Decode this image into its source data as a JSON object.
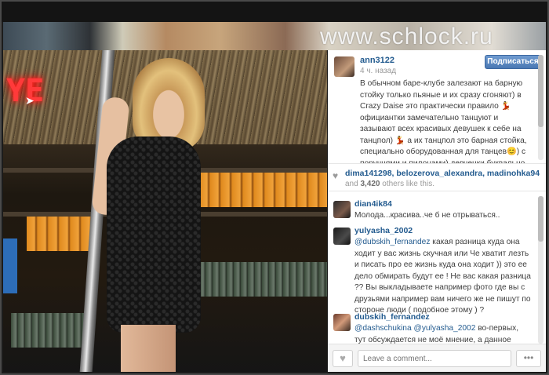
{
  "watermark": "www.schlock.ru",
  "photo": {
    "neon_text": "YE"
  },
  "post": {
    "username": "ann3122",
    "time": "4 ч. назад",
    "follow_label": "Подписаться",
    "caption": "В обычном баре-клубе залезают на барную стойку только пьяные и их сразу сгоняют) в Crazy Daise это практически правило 💃 официантки замечательно танцуют и зазывают всех красивых девушек к себе на танцпол) 💃 а их танцпол это барная стойка, специально оборудованная для танцев😊) с поручнями и пилонами) девченки буквально"
  },
  "likes": {
    "likers": "dima141298, belozerova_alexandra, madinohka94",
    "count_prefix": "and",
    "count": "3,420",
    "count_suffix": "others like this."
  },
  "comments": [
    {
      "username": "dian4ik84",
      "text": "Молода...красива..че б не отрываться.."
    },
    {
      "username": "yulyasha_2002",
      "mention": "@dubskih_fernandez",
      "text": " какая разница куда она ходит у вас жизнь скучная или Че хватит лезть и писать про ее жизнь куда она ходит )) это ее дело обмирать будут ее ! Не вас какая разница ?? Вы выкладываете например фото где вы с друзьями например вам ничего же не пишут по стороне люди ( подобное этому ) ?"
    },
    {
      "username": "dubskih_fernandez",
      "mention": "@dashschukina",
      "mention2": "@yulyasha_2002",
      "text": " во-первых, тут обсуждается не моё мнение, а данное фото, и"
    }
  ],
  "footer": {
    "comment_placeholder": "Leave a comment...",
    "more_label": "•••"
  }
}
